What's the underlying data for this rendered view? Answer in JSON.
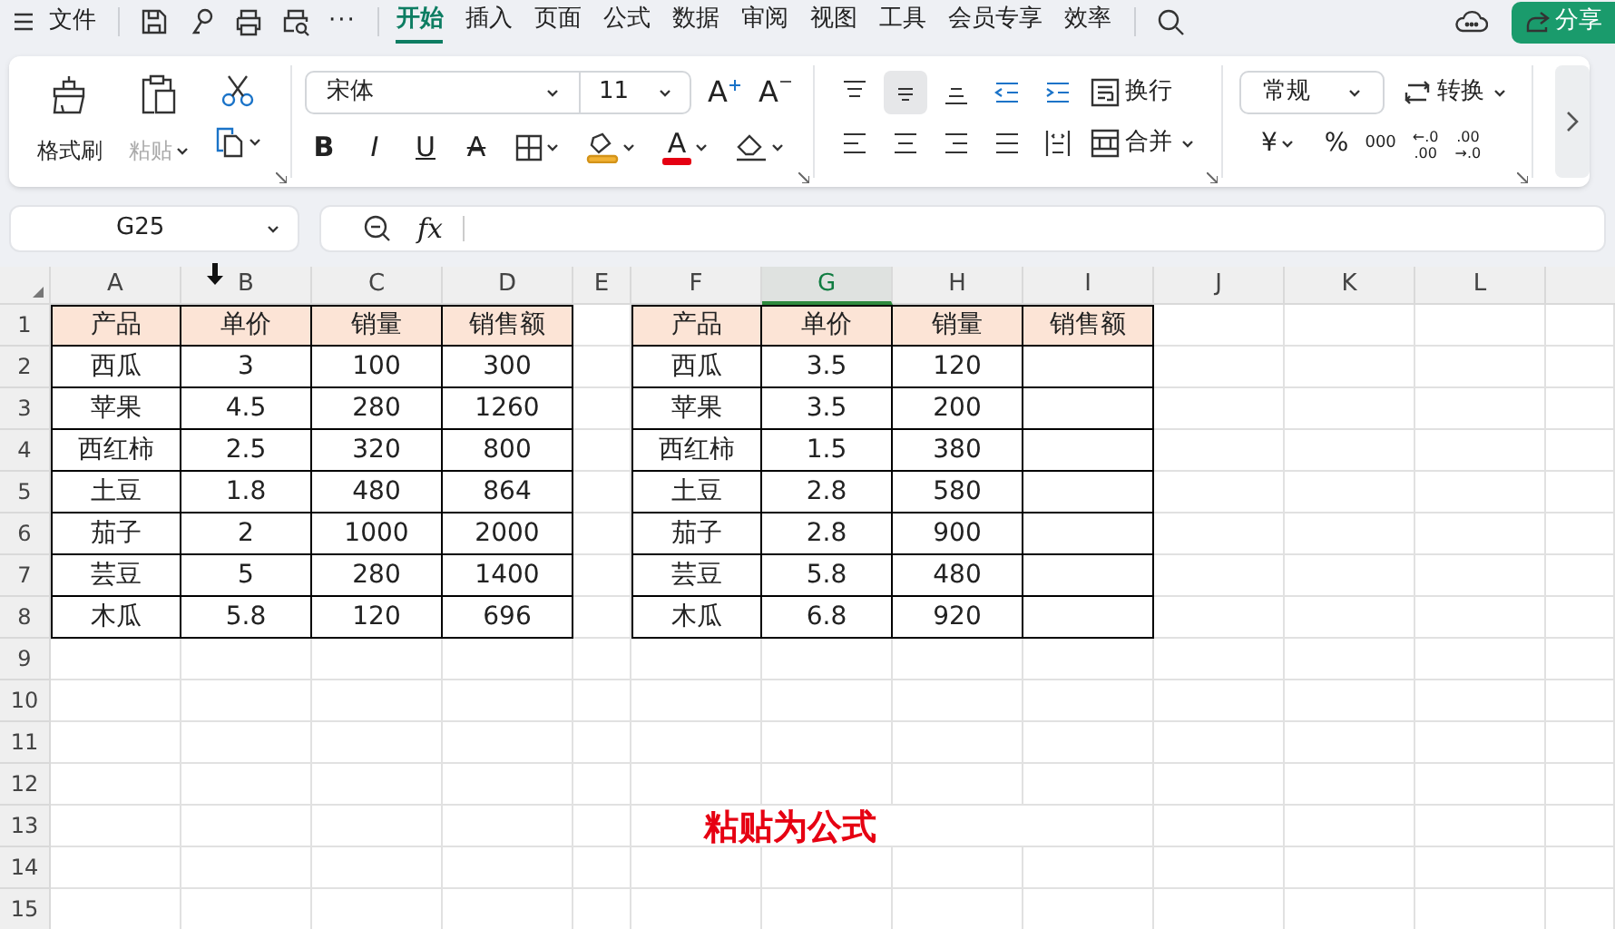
{
  "menu": {
    "label": "文件"
  },
  "more_label": "···",
  "tabs": [
    {
      "label": "开始",
      "selected": true
    },
    {
      "label": "插入",
      "selected": false
    },
    {
      "label": "页面",
      "selected": false
    },
    {
      "label": "公式",
      "selected": false
    },
    {
      "label": "数据",
      "selected": false
    },
    {
      "label": "审阅",
      "selected": false
    },
    {
      "label": "视图",
      "selected": false
    },
    {
      "label": "工具",
      "selected": false
    },
    {
      "label": "会员专享",
      "selected": false
    },
    {
      "label": "效率",
      "selected": false
    }
  ],
  "share_button": {
    "label": "分享"
  },
  "clipboard": {
    "format_painter": "格式刷",
    "paste": {
      "label": "粘贴",
      "disabled": true
    }
  },
  "font": {
    "name": "宋体",
    "size": "11",
    "size_buttons": [
      {
        "kind": "grow",
        "label": "A"
      },
      {
        "kind": "shrink",
        "label": "A"
      }
    ],
    "style_buttons": [
      {
        "kind": "bold",
        "label": "B"
      },
      {
        "kind": "italic",
        "label": "I"
      },
      {
        "kind": "underline",
        "label": "U"
      },
      {
        "kind": "strike",
        "label": "A"
      }
    ],
    "font_color_label": "A"
  },
  "alignment": {
    "buttons": [
      {
        "kind": "top",
        "selected": false
      },
      {
        "kind": "middle",
        "selected": true
      },
      {
        "kind": "bottom",
        "selected": false
      },
      {
        "kind": "outdent",
        "selected": false
      },
      {
        "kind": "indent",
        "selected": false
      }
    ],
    "wrap": "换行",
    "horizontal": [
      {
        "kind": "left",
        "selected": false
      },
      {
        "kind": "center",
        "selected": false
      },
      {
        "kind": "right",
        "selected": false
      },
      {
        "kind": "justify",
        "selected": false
      },
      {
        "kind": "distributed",
        "selected": false
      }
    ],
    "merge": "合并"
  },
  "number": {
    "format": "常规",
    "convert": "转换",
    "currency": "¥",
    "percent": "%",
    "thousands": "000",
    "decimal_increase": [
      "←.0",
      ".00"
    ],
    "decimal_decrease": [
      ".00",
      "→.0"
    ]
  },
  "name_box": "G25",
  "formula_bar": {
    "fx": "fx"
  },
  "columns": [
    {
      "label": "A",
      "selected": false
    },
    {
      "label": "B",
      "selected": false
    },
    {
      "label": "C",
      "selected": false
    },
    {
      "label": "D",
      "selected": false
    },
    {
      "label": "E",
      "selected": false
    },
    {
      "label": "F",
      "selected": false
    },
    {
      "label": "G",
      "selected": true
    },
    {
      "label": "H",
      "selected": false
    },
    {
      "label": "I",
      "selected": false
    },
    {
      "label": "J",
      "selected": false
    },
    {
      "label": "K",
      "selected": false
    },
    {
      "label": "L",
      "selected": false
    }
  ],
  "rows": [
    "1",
    "2",
    "3",
    "4",
    "5",
    "6",
    "7",
    "8",
    "9",
    "10",
    "11",
    "12",
    "13",
    "14",
    "15"
  ],
  "table_1": {
    "header": [
      "产品",
      "单价",
      "销量",
      "销售额"
    ],
    "rows": [
      [
        "西瓜",
        "3",
        "100",
        "300"
      ],
      [
        "苹果",
        "4.5",
        "280",
        "1260"
      ],
      [
        "西红柿",
        "2.5",
        "320",
        "800"
      ],
      [
        "土豆",
        "1.8",
        "480",
        "864"
      ],
      [
        "茄子",
        "2",
        "1000",
        "2000"
      ],
      [
        "芸豆",
        "5",
        "280",
        "1400"
      ],
      [
        "木瓜",
        "5.8",
        "120",
        "696"
      ]
    ]
  },
  "table_2": {
    "header": [
      "产品",
      "单价",
      "销量",
      "销售额"
    ],
    "rows": [
      [
        "西瓜",
        "3.5",
        "120"
      ],
      [
        "苹果",
        "3.5",
        "200"
      ],
      [
        "西红柿",
        "1.5",
        "380"
      ],
      [
        "土豆",
        "2.8",
        "580"
      ],
      [
        "茄子",
        "2.8",
        "900"
      ],
      [
        "芸豆",
        "5.8",
        "480"
      ],
      [
        "木瓜",
        "6.8",
        "920"
      ]
    ]
  },
  "caption": "粘贴为公式"
}
